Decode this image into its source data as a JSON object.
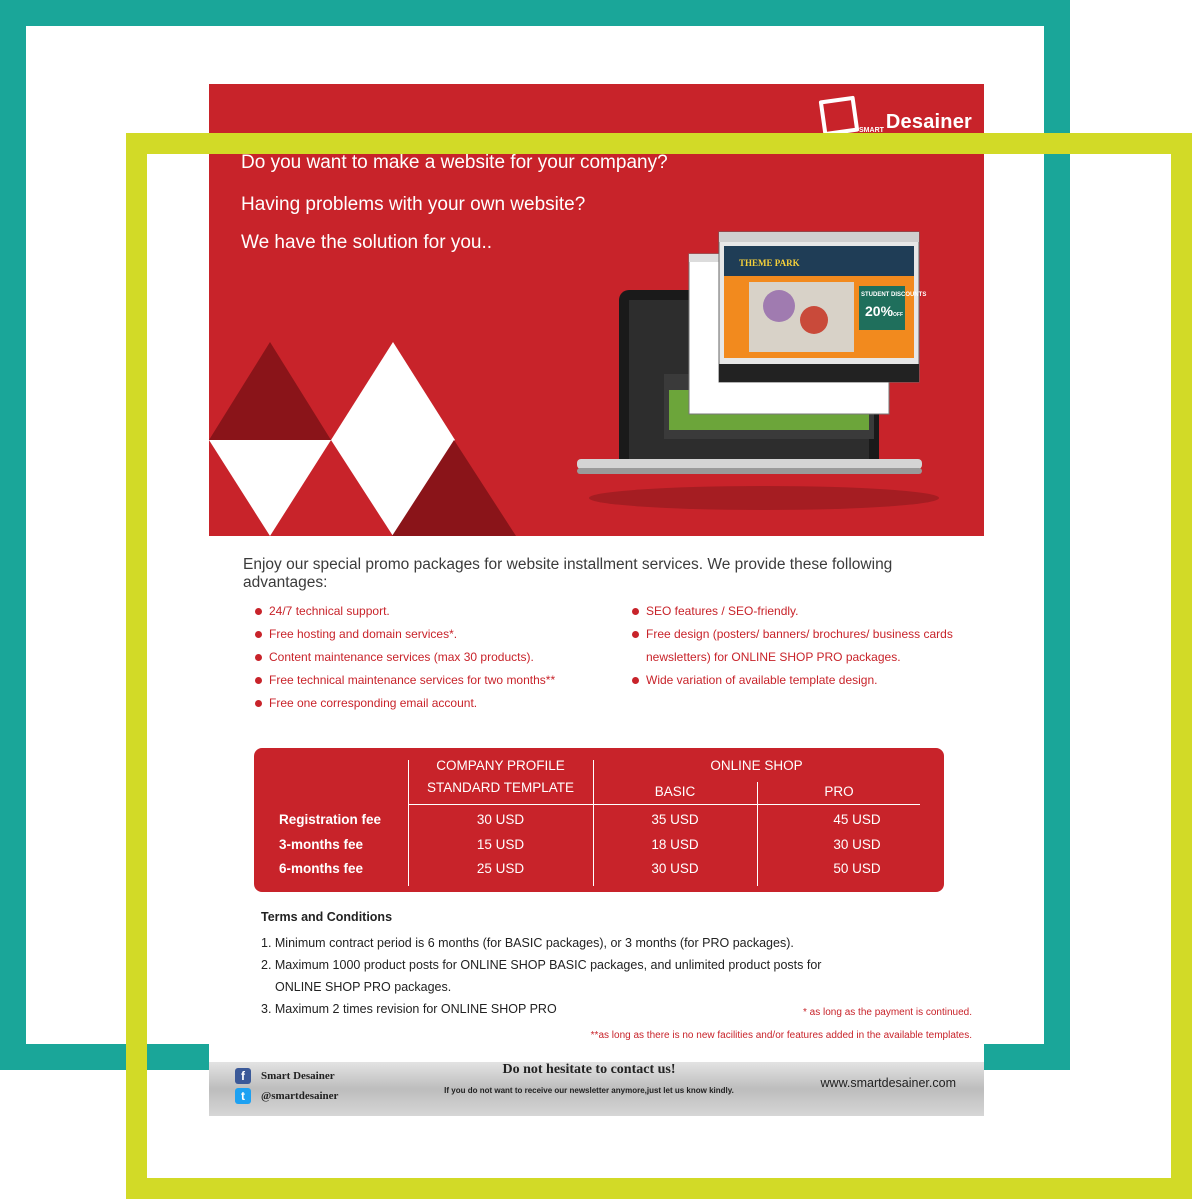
{
  "colors": {
    "teal_frame": "#1aa699",
    "lime_frame": "#d2da27",
    "brand_red": "#c8232a",
    "dark_red": "#8a1419"
  },
  "logo": {
    "small": "SMART",
    "big": "Desainer"
  },
  "hero": {
    "headline_1": "Do you want to make a website for your company?",
    "headline_2": "Having problems with your own website?",
    "headline_3": "We have the solution for you..",
    "screen_title": "THEME PARK",
    "screen_badge": "STUDENT DISCOUNTS",
    "screen_discount": "20%",
    "screen_off": "OFF"
  },
  "promo_text": "Enjoy our special promo packages for website installment services. We provide these following advantages:",
  "advantages_left": [
    "24/7 technical support.",
    "Free hosting and domain services*.",
    "Content maintenance services (max 30 products).",
    "Free technical maintenance services for two months**",
    "Free one corresponding email account."
  ],
  "advantages_right": [
    "SEO features / SEO-friendly.",
    "Free design (posters/ banners/ brochures/ business cards",
    "newsletters) for ONLINE SHOP PRO packages.",
    "Wide variation of available template design."
  ],
  "pricing": {
    "col_company_1": "COMPANY PROFILE",
    "col_company_2": "STANDARD TEMPLATE",
    "col_online_shop": "ONLINE SHOP",
    "col_basic": "BASIC",
    "col_pro": "PRO",
    "rows": [
      {
        "label": "Registration fee",
        "company": "30 USD",
        "basic": "35 USD",
        "pro": "45 USD"
      },
      {
        "label": "3-months fee",
        "company": "15 USD",
        "basic": "18 USD",
        "pro": "30 USD"
      },
      {
        "label": "6-months fee",
        "company": "25 USD",
        "basic": "30 USD",
        "pro": "50 USD"
      }
    ]
  },
  "terms": {
    "title": "Terms and Conditions",
    "item_1": "1. Minimum contract period is 6 months (for BASIC packages), or 3 months (for PRO packages).",
    "item_2a": "2. Maximum 1000 product posts for ONLINE SHOP BASIC packages, and unlimited product posts for",
    "item_2b": "ONLINE SHOP PRO packages.",
    "item_3": "3. Maximum 2 times revision for ONLINE SHOP PRO"
  },
  "notes": {
    "note_1": "* as long as the payment is continued.",
    "note_2": "**as long as there is no new facilities and/or features added in the available templates."
  },
  "footer": {
    "facebook_name": "Smart Desainer",
    "twitter_handle": "@smartdesainer",
    "cta": "Do not hesitate to contact us!",
    "unsubscribe": "If you do not want to receive our newsletter anymore,just let us know kindly.",
    "website": "www.smartdesainer.com",
    "facebook_icon": "f",
    "twitter_icon": "t"
  }
}
